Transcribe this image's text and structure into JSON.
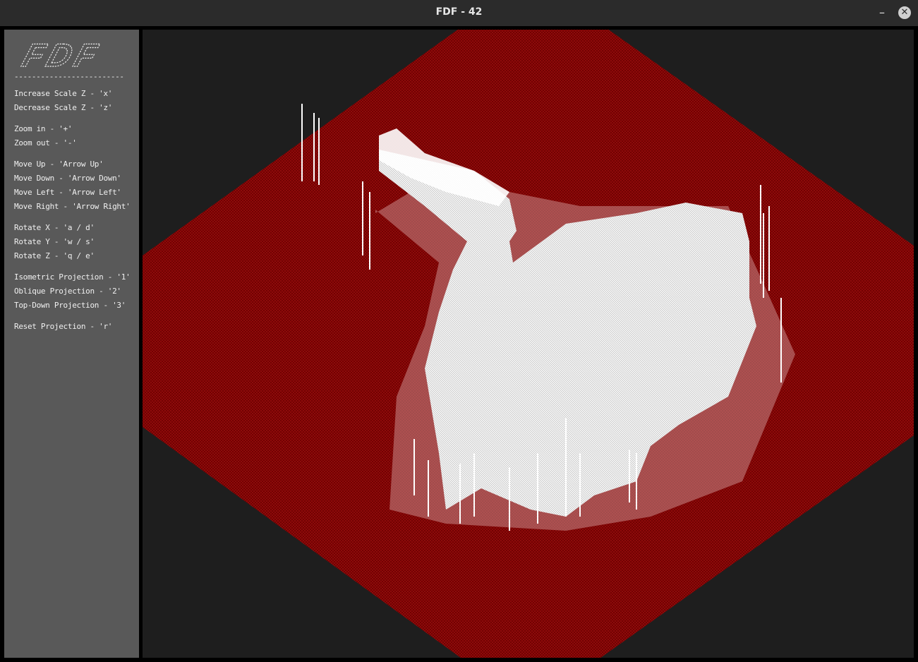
{
  "window": {
    "title": "FDF - 42",
    "minimize_label": "–",
    "close_label": "✕"
  },
  "sidebar": {
    "logo_text": "FDF",
    "separator": "-------------------------",
    "help_lines": [
      "Increase Scale Z - 'x'",
      "Decrease Scale Z - 'z'",
      "Zoom in - '+'",
      "Zoom out - '-'",
      "Move Up - 'Arrow Up'",
      "Move Down - 'Arrow Down'",
      "Move Left - 'Arrow Left'",
      "Move Right - 'Arrow Right'",
      "Rotate X - 'a / d'",
      "Rotate Y - 'w / s'",
      "Rotate Z - 'q / e'",
      "Isometric Projection - '1'",
      "Oblique Projection - '2'",
      "Top-Down Projection - '3'",
      "Reset Projection - 'r'"
    ]
  },
  "render": {
    "colors": {
      "background": "#1e1e1e",
      "wire_low": "#7a0000",
      "wire_high": "#ffffff",
      "sidebar": "#595959"
    }
  }
}
